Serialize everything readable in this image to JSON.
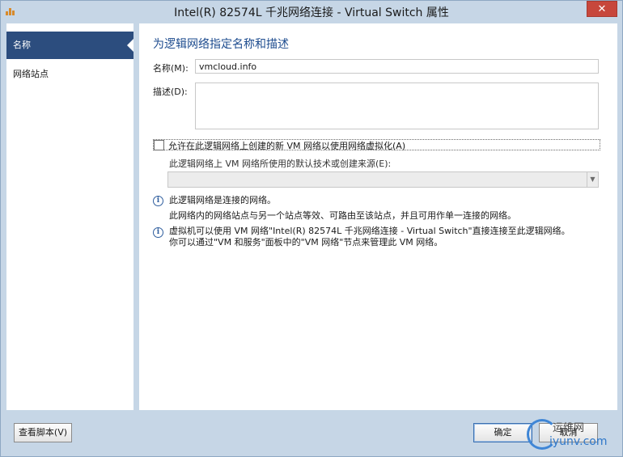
{
  "window": {
    "title": "Intel(R) 82574L 千兆网络连接 - Virtual Switch 属性",
    "close_symbol": "✕"
  },
  "sidebar": {
    "items": [
      {
        "label": "名称"
      },
      {
        "label": "网络站点"
      }
    ]
  },
  "main": {
    "heading": "为逻辑网络指定名称和描述",
    "name_label": "名称(M):",
    "name_value": "vmcloud.info",
    "description_label": "描述(D):",
    "description_value": "",
    "checkbox_label": "允许在此逻辑网络上创建的新 VM 网络以使用网络虚拟化(A)",
    "dropdown_label": "此逻辑网络上 VM 网络所使用的默认技术或创建来源(E):",
    "dropdown_value": "",
    "info1_line1": "此逻辑网络是连接的网络。",
    "info1_line2": "此网络内的网络站点与另一个站点等效、可路由至该站点，并且可用作单一连接的网络。",
    "info2_line1": "虚拟机可以使用 VM 网络\"Intel(R) 82574L 千兆网络连接 - Virtual Switch\"直接连接至此逻辑网络。",
    "info2_line2": "你可以通过\"VM 和服务\"面板中的\"VM 网络\"节点来管理此 VM 网络。",
    "info_symbol": "i"
  },
  "footer": {
    "view_script_label": "查看脚本(V)",
    "ok_label": "确定",
    "cancel_label": "取消"
  },
  "watermark": {
    "text1": "运维网",
    "text2": "iyunv.com"
  }
}
